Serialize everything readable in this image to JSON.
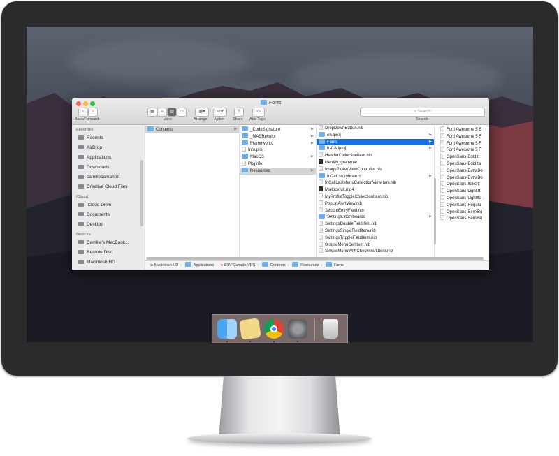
{
  "window": {
    "title": "Fonts"
  },
  "toolbar": {
    "back_forward_label": "Back/Forward",
    "view_label": "View",
    "arrange_label": "Arrange",
    "action_label": "Action",
    "share_label": "Share",
    "add_tags_label": "Add Tags",
    "search_placeholder": "Search",
    "search_label": "Search"
  },
  "sidebar": {
    "favorites_header": "Favorites",
    "favorites": [
      "Recents",
      "AirDrop",
      "Applications",
      "Downloads",
      "camillecamahort",
      "Creative Cloud Files"
    ],
    "icloud_header": "iCloud",
    "icloud": [
      "iCloud Drive",
      "Documents",
      "Desktop"
    ],
    "devices_header": "Devices",
    "devices": [
      "Camille's MacBook...",
      "Remote Disc",
      "Macintosh HD"
    ]
  },
  "columns": {
    "col1": [
      "Contents"
    ],
    "col2": [
      "_CodeSignature",
      "_MASReceipt",
      "Frameworks",
      "Info.plist",
      "MacOS",
      "PkgInfo",
      "Resources"
    ],
    "col3": [
      "DropDownButton.nib",
      "en.lproj",
      "Fonts",
      "fr-CA.lproj",
      "HeaderCollectionItem.nib",
      "identity_grammar",
      "ImagePickerViewController.nib",
      "InCall.storyboardc",
      "InCallLastMenuCollectionViewItem.nib",
      "Mailboxfull.mp4",
      "MyProfileToggleCollectionItem.nib",
      "PopUpAlertView.nib",
      "SecureEntryField.nib",
      "Settings.storyboardc",
      "SettingsDoubleFieldItem.nib",
      "SettingsSingleFieldItem.nib",
      "SettingsTrippleFieldItem.nib",
      "SimpleMenuCellItem.nib",
      "SimpleMenuWithCheckmarkItem.nib"
    ],
    "col4": [
      "Font Awesome 5 B",
      "Font Awesome 5 F",
      "Font Awesome 5 F",
      "Font Awesome 5 F",
      "OpenSans-Bold.tt",
      "OpenSans-BoldIta",
      "OpenSans-ExtraBo",
      "OpenSans-ExtraBo",
      "OpenSans-Italic.tt",
      "OpenSans-Light.tt",
      "OpenSans-LightIta",
      "OpenSans-Regula",
      "OpenSans-SemiBo",
      "OpenSans-SemiBo"
    ]
  },
  "pathbar": [
    "Macintosh HD",
    "Applications",
    "SRV Canada VRS",
    "Contents",
    "Resources",
    "Fonts"
  ],
  "colors": {
    "selection": "#1a6fe0",
    "folder": "#6fb1ea"
  }
}
